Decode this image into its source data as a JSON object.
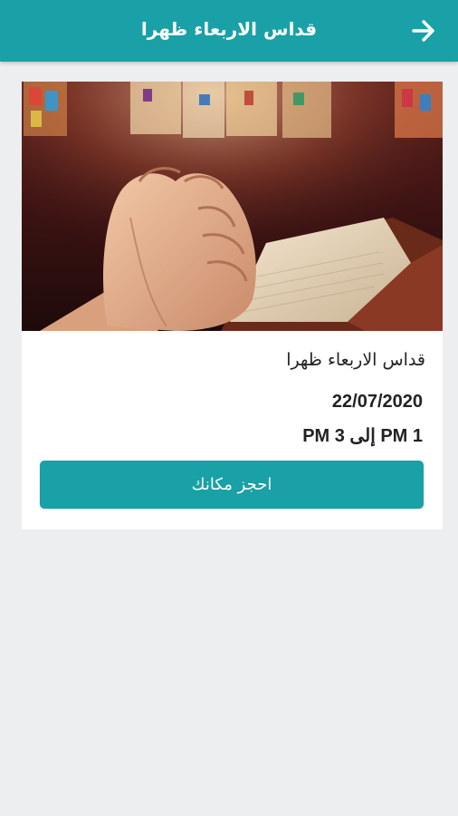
{
  "app_bar": {
    "title": "قداس الاربعاء ظهرا",
    "back_icon": "arrow-right-icon",
    "color": "#1aa0a7"
  },
  "event": {
    "image_icon": "praying-hands-bible-image",
    "title": "قداس الاربعاء ظهرا",
    "date": "22/07/2020",
    "time": "1 PM إلى 3 PM",
    "book_label": "احجز مكانك"
  }
}
